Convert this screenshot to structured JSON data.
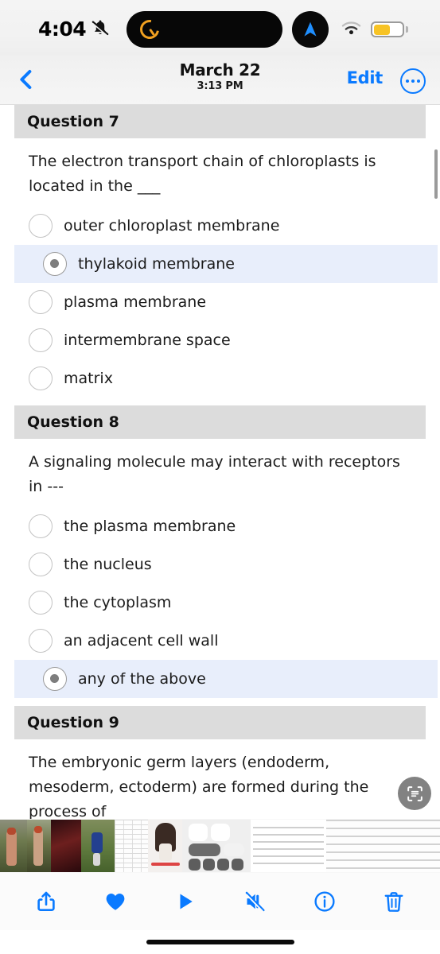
{
  "status_bar": {
    "time": "4:04",
    "silent_icon": "bell-slash-icon",
    "dynamic_island_icon": "timer-icon",
    "navigation_icon": "location-arrow-icon",
    "wifi_icon": "wifi-icon",
    "battery_icon": "battery-low-power-icon",
    "battery_color": "#f7c325",
    "battery_percent": 55
  },
  "nav_bar": {
    "back_icon": "chevron-left-icon",
    "title": "March 22",
    "subtitle": "3:13 PM",
    "edit_label": "Edit",
    "more_icon": "ellipsis-circle-icon",
    "accent_color": "#0a7aff"
  },
  "photo_content": {
    "live_text_button_icon": "live-text-scan-icon",
    "scrollbar": "vertical-scroll-indicator",
    "header_bg": "#dcdcdc",
    "selected_option_bg": "#e8eefb",
    "questions": [
      {
        "header": "Question 7",
        "prompt": "The electron transport chain of chloroplasts is located in the  ___",
        "options": [
          {
            "label": "outer chloroplast membrane",
            "selected": false
          },
          {
            "label": "thylakoid membrane",
            "selected": true
          },
          {
            "label": "plasma membrane",
            "selected": false
          },
          {
            "label": "intermembrane space",
            "selected": false
          },
          {
            "label": "matrix",
            "selected": false
          }
        ]
      },
      {
        "header": "Question 8",
        "prompt": "A signaling molecule may interact with receptors in ---",
        "options": [
          {
            "label": "the plasma membrane",
            "selected": false
          },
          {
            "label": "the nucleus",
            "selected": false
          },
          {
            "label": "the cytoplasm",
            "selected": false
          },
          {
            "label": "an adjacent cell wall",
            "selected": false
          },
          {
            "label": "any of the above",
            "selected": true
          }
        ]
      },
      {
        "header": "Question 9",
        "prompt": "The embryonic germ layers (endoderm, mesoderm, ectoderm) are formed during the process of ___",
        "options": []
      }
    ]
  },
  "filmstrip": {
    "thumbnails": [
      {
        "name": "photo-person-outdoors",
        "selected": false
      },
      {
        "name": "photo-person-outdoors-2",
        "selected": false
      },
      {
        "name": "photo-dark-red",
        "selected": false
      },
      {
        "name": "photo-soccer-player",
        "selected": false
      },
      {
        "name": "screenshot-spreadsheet",
        "selected": false
      },
      {
        "name": "photo-woman-white-dress",
        "selected": false
      },
      {
        "name": "screenshot-control-center",
        "selected": false
      },
      {
        "name": "screenshot-quiz-current",
        "selected": true
      },
      {
        "name": "screenshot-quiz-next",
        "selected": false
      },
      {
        "name": "screenshot-quiz-next-2",
        "selected": false
      }
    ]
  },
  "toolbar": {
    "accent_color": "#0a7aff",
    "items": [
      {
        "name": "share-icon",
        "label": "Share"
      },
      {
        "name": "heart-filled-icon",
        "label": "Favorite"
      },
      {
        "name": "play-icon",
        "label": "Play"
      },
      {
        "name": "speaker-mute-icon",
        "label": "Mute"
      },
      {
        "name": "info-circle-icon",
        "label": "Info"
      },
      {
        "name": "trash-icon",
        "label": "Delete"
      }
    ]
  }
}
